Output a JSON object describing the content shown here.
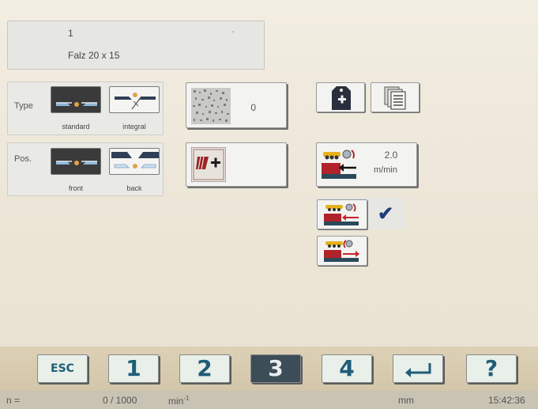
{
  "program": {
    "number": "1",
    "dash": "-",
    "name": "Falz 20 x 15"
  },
  "type_panel": {
    "label": "Type",
    "options": [
      {
        "caption": "standard",
        "selected": true
      },
      {
        "caption": "integral",
        "selected": false
      }
    ]
  },
  "pos_panel": {
    "label": "Pos.",
    "options": [
      {
        "caption": "front",
        "selected": true
      },
      {
        "caption": "back",
        "selected": false
      }
    ]
  },
  "counter": {
    "value": "0"
  },
  "speed": {
    "value": "2.0",
    "unit": "m/min"
  },
  "keys": {
    "esc": "ESC",
    "k1": "1",
    "k2": "2",
    "k3": "3",
    "k4": "4",
    "help": "?"
  },
  "active_key": "3",
  "status": {
    "n_label": "n =",
    "count": "0 / 1000",
    "unit": "min",
    "unit_sup": "-1",
    "length_unit": "mm",
    "time": "15:42:36"
  },
  "colors": {
    "accent": "#1f5d78",
    "check": "#1e3e7a",
    "machine_red": "#b0232a",
    "machine_yellow": "#e4b21c"
  }
}
